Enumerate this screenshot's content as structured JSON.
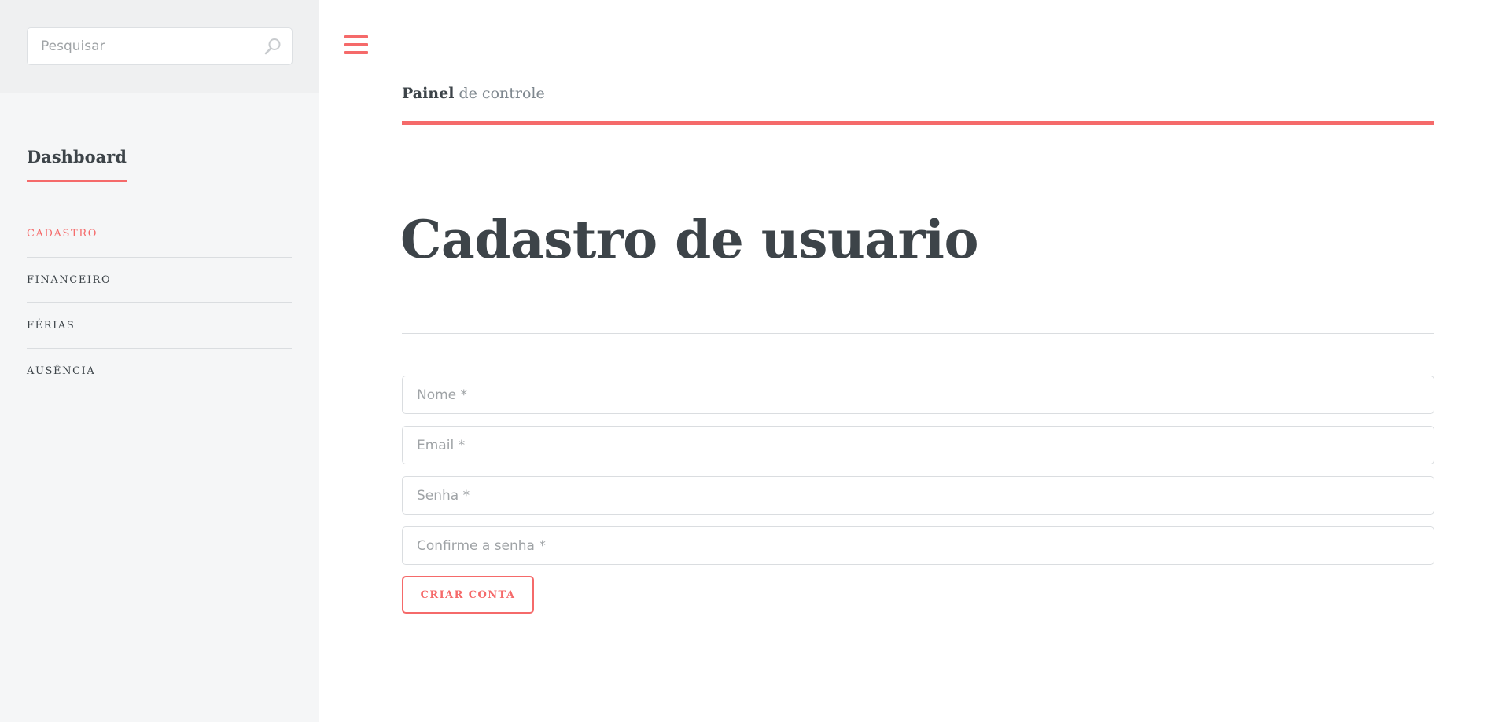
{
  "search": {
    "placeholder": "Pesquisar",
    "icon": "search-icon"
  },
  "sidebar": {
    "title": "Dashboard",
    "items": [
      {
        "label": "CADASTRO",
        "active": true
      },
      {
        "label": "FINANCEIRO",
        "active": false
      },
      {
        "label": "FÉRIAS",
        "active": false
      },
      {
        "label": "AUSÊNCIA",
        "active": false
      }
    ]
  },
  "header": {
    "strong": "Painel",
    "rest": " de controle",
    "menu_icon": "hamburger-menu-icon"
  },
  "main": {
    "title": "Cadastro de usuario",
    "form": {
      "name_placeholder": "Nome *",
      "email_placeholder": "Email *",
      "password_placeholder": "Senha *",
      "confirm_placeholder": "Confirme a senha *",
      "submit_label": "CRIAR CONTA"
    }
  },
  "colors": {
    "accent": "#f56a6a",
    "text": "#3d4449",
    "sidebar_bg": "#f5f6f7",
    "muted": "#7f888f"
  }
}
